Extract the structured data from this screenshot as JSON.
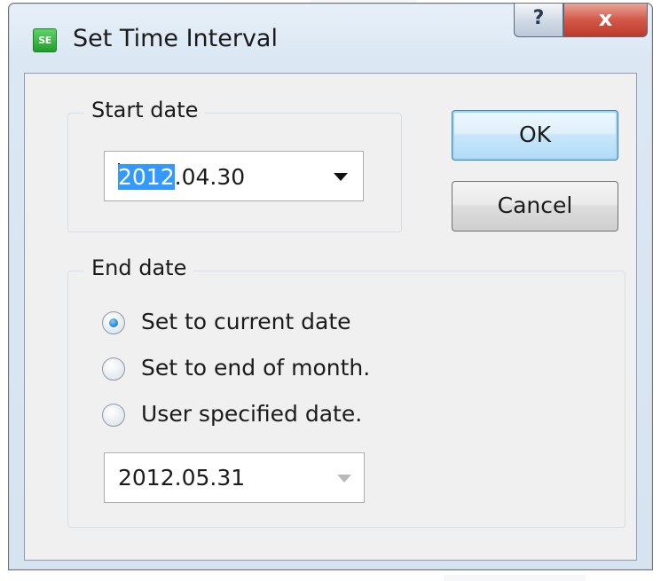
{
  "window": {
    "title": "Set Time Interval",
    "app_icon_text": "SE",
    "help_glyph": "?",
    "close_glyph": "x"
  },
  "start_date": {
    "group_label": "Start date",
    "value_selected": "2012",
    "value_rest": ".04.30",
    "arrow_icon": "dropdown-arrow"
  },
  "buttons": {
    "ok_label": "OK",
    "cancel_label": "Cancel"
  },
  "end_date": {
    "group_label": "End date",
    "options": [
      {
        "label": "Set to current date",
        "selected": true
      },
      {
        "label": "Set to end of month.",
        "selected": false
      },
      {
        "label": "User specified date.",
        "selected": false
      }
    ],
    "date_value": "2012.05.31",
    "date_enabled": false
  },
  "colors": {
    "selection": "#3399ff",
    "close_button": "#c0392b",
    "app_icon": "#1f9e2c",
    "dialog_face": "#f0f0f0"
  }
}
